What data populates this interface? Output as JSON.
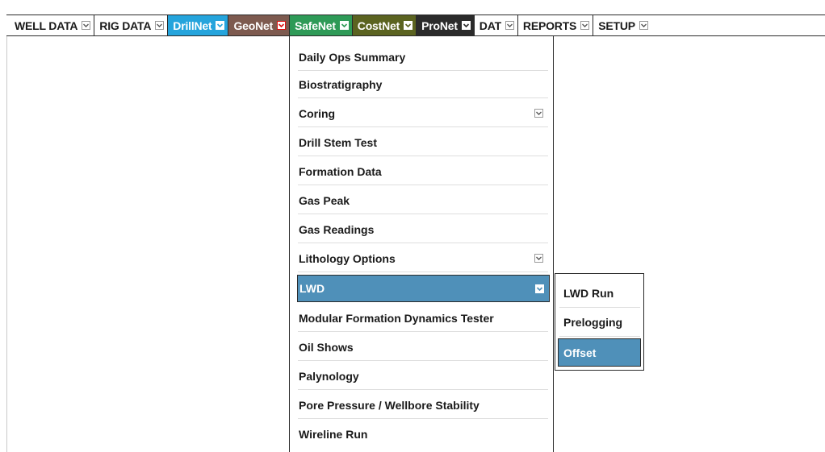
{
  "menubar": {
    "items": [
      {
        "label": "WELL DATA",
        "icon": "chevron-down-icon"
      },
      {
        "label": "RIG DATA",
        "icon": "chevron-down-icon"
      },
      {
        "label": "DrillNet",
        "icon": "chevron-down-icon",
        "color": "#25a4dc"
      },
      {
        "label": "GeoNet",
        "icon": "chevron-down-icon",
        "color": "#7d5a4f"
      },
      {
        "label": "SafeNet",
        "icon": "chevron-down-icon",
        "color": "#2e9a57"
      },
      {
        "label": "CostNet",
        "icon": "chevron-down-icon",
        "color": "#5b6320"
      },
      {
        "label": "ProNet",
        "icon": "chevron-down-icon",
        "color": "#2b2b2b"
      },
      {
        "label": "DAT",
        "icon": "chevron-down-icon"
      },
      {
        "label": "REPORTS",
        "icon": "chevron-down-icon"
      },
      {
        "label": "SETUP",
        "icon": "chevron-down-icon"
      }
    ]
  },
  "geonet_menu": {
    "items": [
      {
        "label": "Daily Ops Summary"
      },
      {
        "label": "Biostratigraphy"
      },
      {
        "label": "Coring",
        "has_submenu": true
      },
      {
        "label": "Drill Stem Test"
      },
      {
        "label": "Formation Data"
      },
      {
        "label": "Gas Peak"
      },
      {
        "label": "Gas Readings"
      },
      {
        "label": "Lithology Options",
        "has_submenu": true
      },
      {
        "label": "LWD",
        "has_submenu": true,
        "active": true
      },
      {
        "label": "Modular Formation Dynamics Tester"
      },
      {
        "label": "Oil Shows"
      },
      {
        "label": "Palynology"
      },
      {
        "label": "Pore Pressure / Wellbore Stability"
      },
      {
        "label": "Wireline Run"
      }
    ]
  },
  "lwd_submenu": {
    "items": [
      {
        "label": "LWD Run"
      },
      {
        "label": "Prelogging"
      },
      {
        "label": "Offset",
        "active": true
      }
    ]
  },
  "colors": {
    "active_item": "#4f90b9",
    "drillnet": "#25a4dc",
    "geonet": "#7d5a4f",
    "safenet": "#2e9a57",
    "costnet": "#5b6320",
    "pronet": "#2b2b2b"
  }
}
